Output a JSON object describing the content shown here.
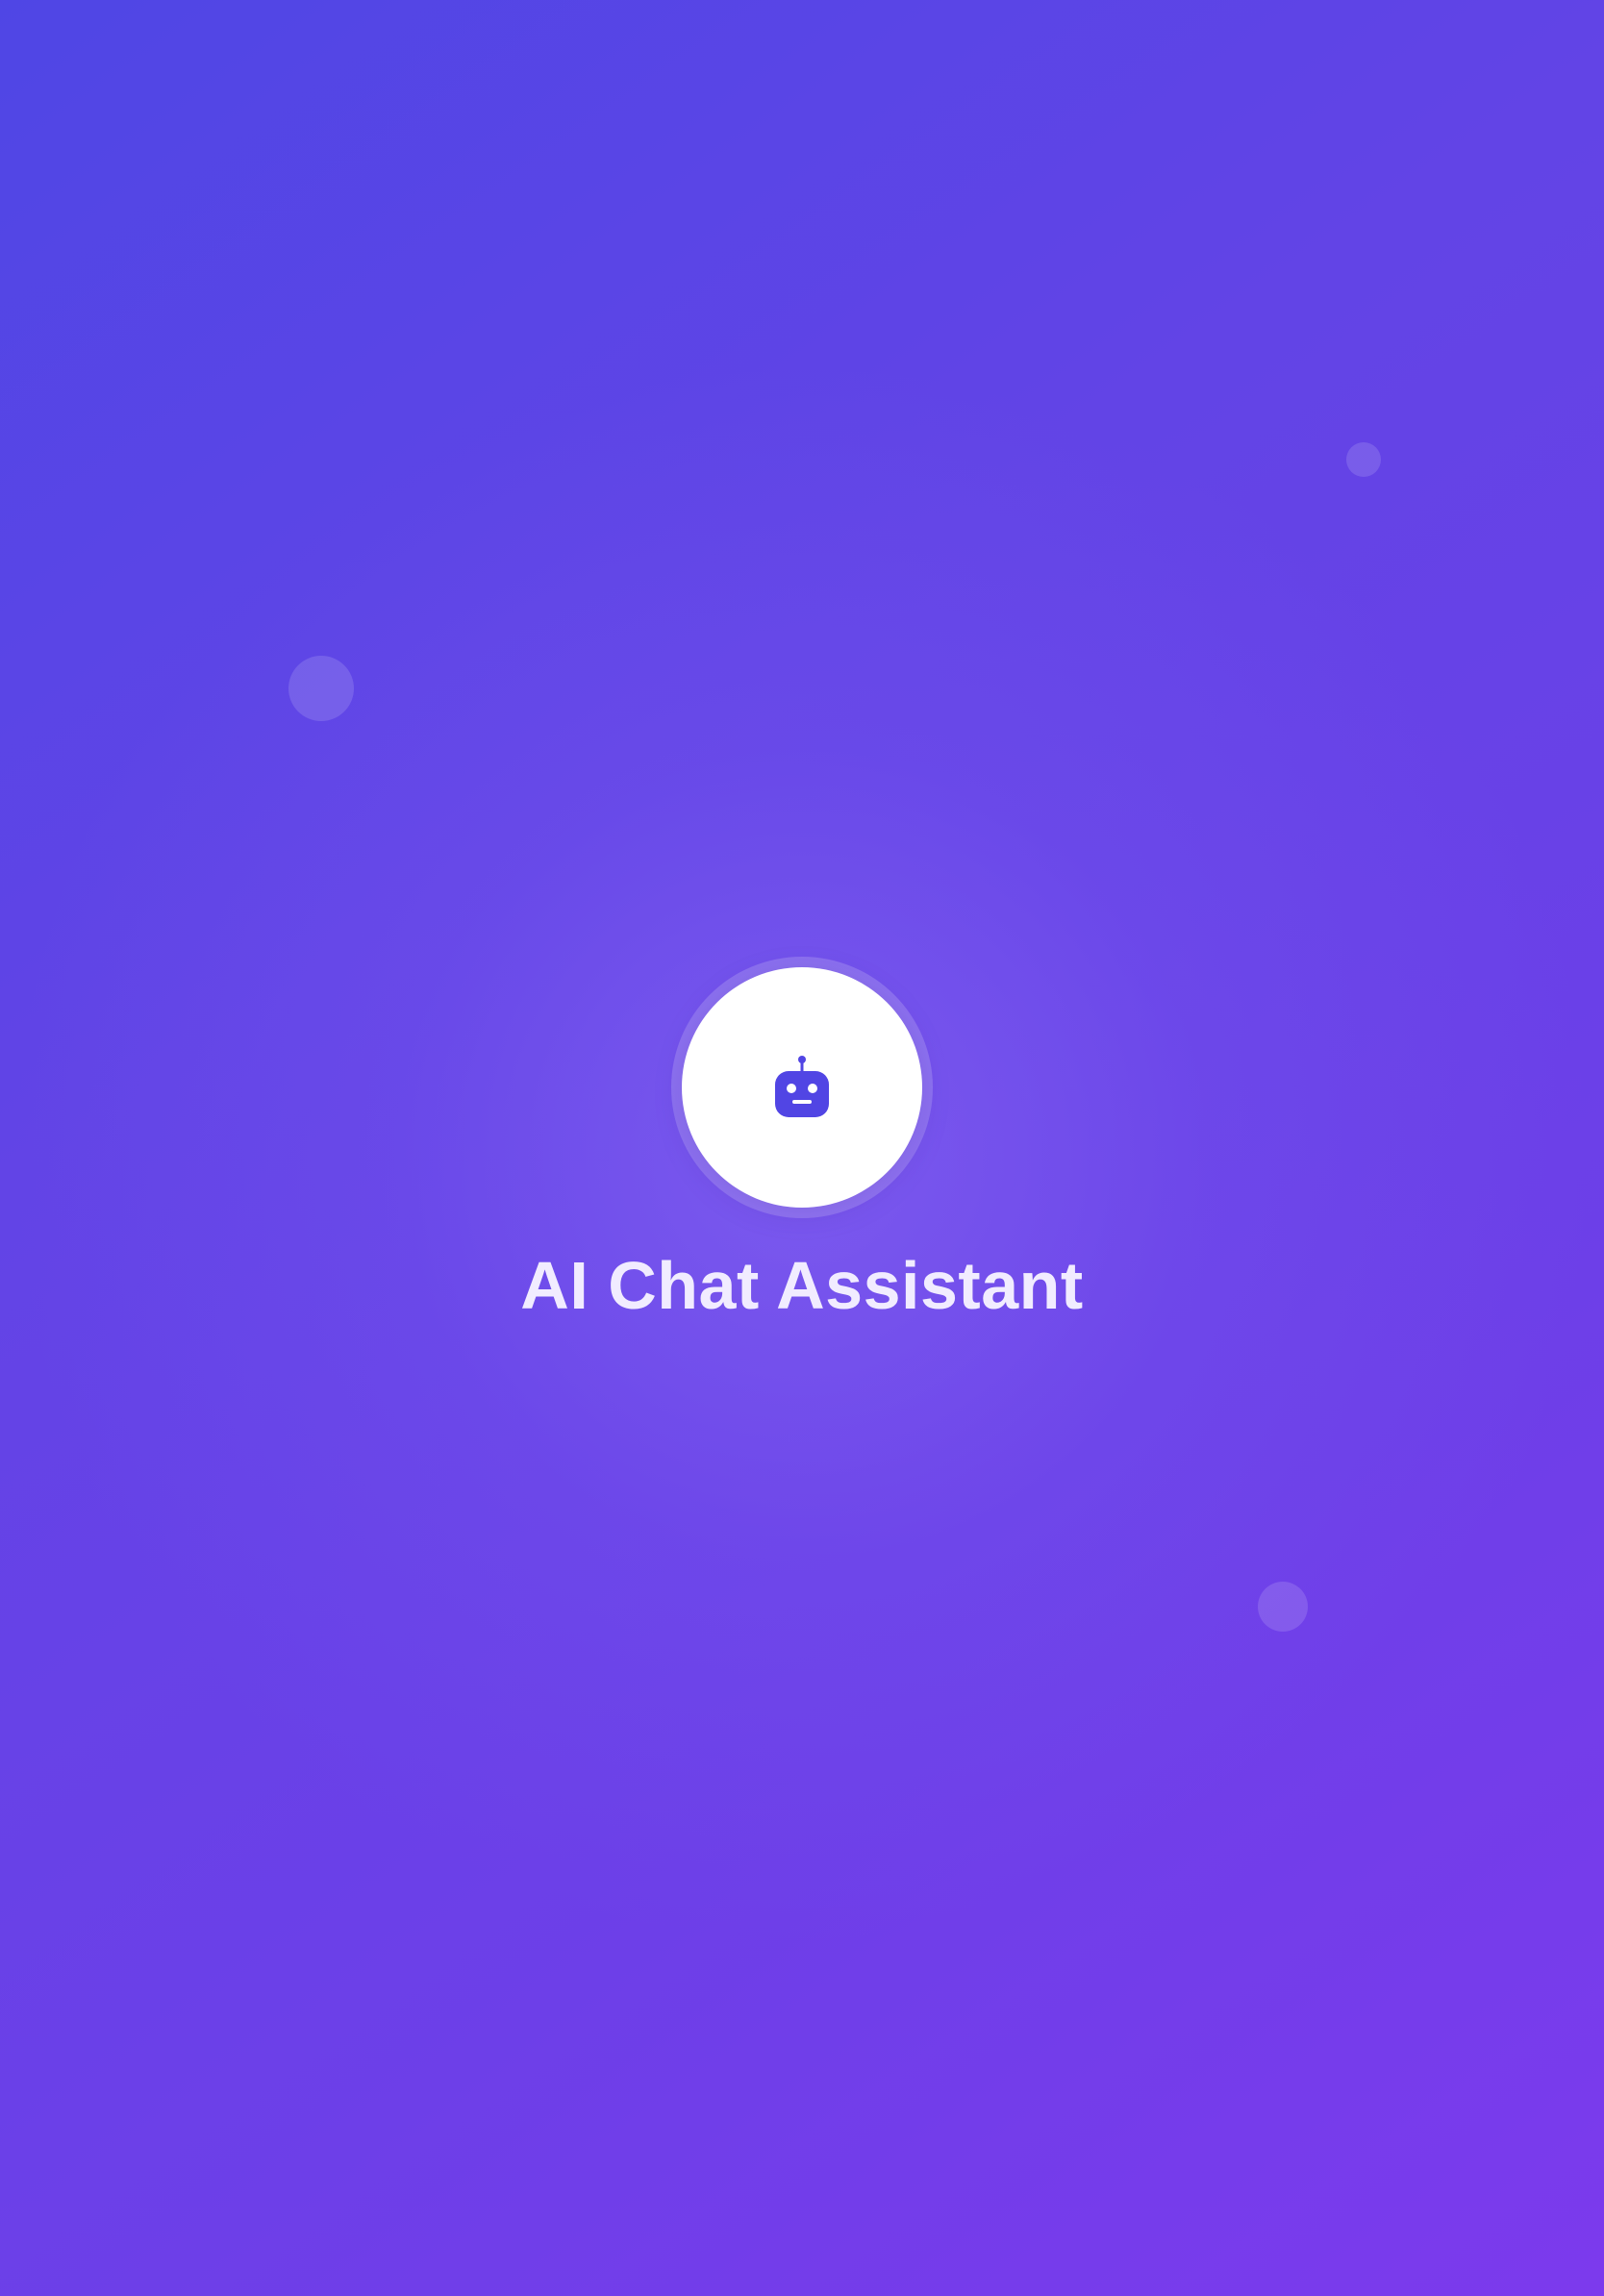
{
  "app": {
    "title": "AI Chat Assistant"
  },
  "logo": {
    "icon": "robot-icon"
  },
  "colors": {
    "gradient_start": "#4f46e5",
    "gradient_end": "#7c3aed",
    "logo_background": "#ffffff",
    "icon_color": "#5145e4",
    "title_color": "#f1ecff"
  }
}
